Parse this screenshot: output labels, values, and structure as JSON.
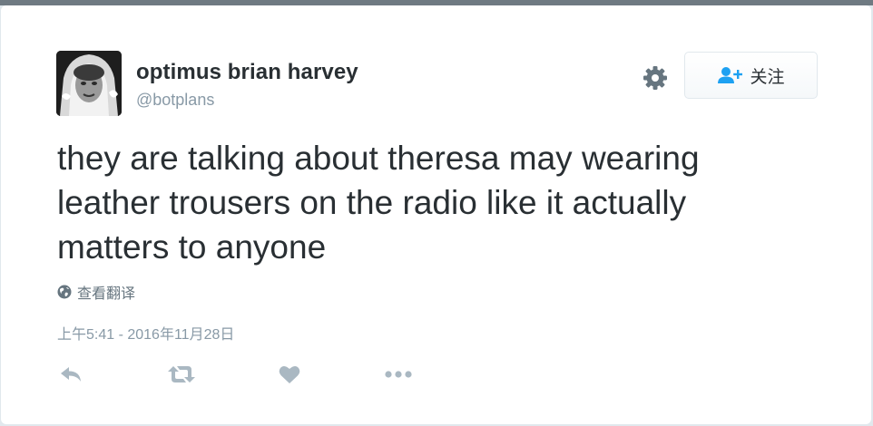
{
  "profile": {
    "display_name": "optimus brian harvey",
    "handle": "@botplans"
  },
  "follow_button": {
    "label": "关注",
    "icon": "add-user-icon"
  },
  "settings_icon": "gear-icon",
  "tweet": {
    "text": "they are talking about theresa may wearing leather trousers on the radio like it actually matters to anyone"
  },
  "translate": {
    "label": "查看翻译",
    "icon": "globe-icon"
  },
  "timestamp": "上午5:41 - 2016年11月28日",
  "actions": [
    {
      "icon": "reply-icon"
    },
    {
      "icon": "retweet-icon"
    },
    {
      "icon": "heart-icon"
    },
    {
      "icon": "more-icon"
    }
  ],
  "colors": {
    "text": "#292f33",
    "muted": "#8899a6",
    "action_icon": "#aab8c2",
    "follow_icon": "#1da1f2"
  }
}
